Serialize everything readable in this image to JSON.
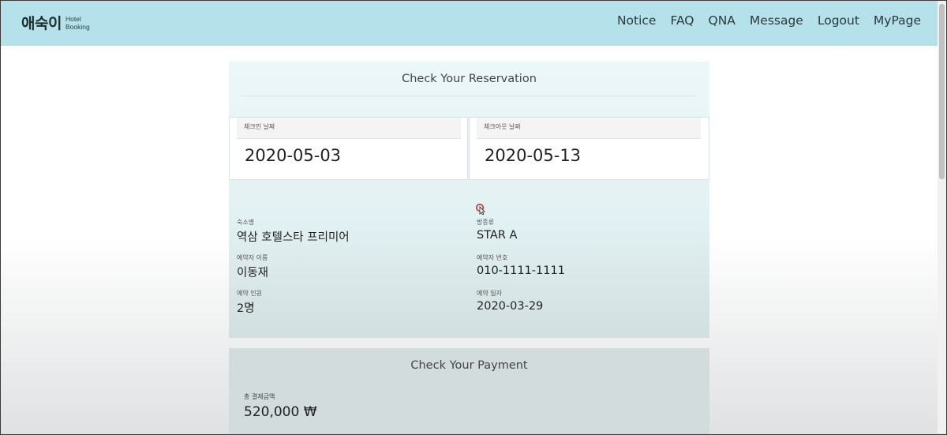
{
  "header": {
    "logo": {
      "main": "애숙이",
      "sub_line1": "Hotel",
      "sub_line2": "Booking"
    },
    "nav": [
      "Notice",
      "FAQ",
      "QNA",
      "Message",
      "Logout",
      "MyPage"
    ]
  },
  "reservation": {
    "title": "Check Your Reservation",
    "check_in": {
      "label": "체크인 날짜",
      "value": "2020-05-03"
    },
    "check_out": {
      "label": "체크아웃 날짜",
      "value": "2020-05-13"
    },
    "hotel_name": {
      "label": "숙소명",
      "value": "역삼 호텔스타 프리미어"
    },
    "room_type": {
      "label": "방종류",
      "value": "STAR A"
    },
    "guest_name": {
      "label": "예약자 이름",
      "value": "이동재"
    },
    "guest_phone": {
      "label": "예약자 번호",
      "value": "010-1111-1111"
    },
    "guest_count": {
      "label": "예약 인원",
      "value": "2명"
    },
    "reservation_date": {
      "label": "예약 일자",
      "value": "2020-03-29"
    }
  },
  "payment": {
    "title": "Check Your Payment",
    "total": {
      "label": "총 결제금액",
      "value": "520,000 ₩"
    }
  },
  "colors": {
    "header_bg": "#b4e1ea",
    "card_bg": "#ecf7f9",
    "payment_bg": "#d3dcdd",
    "cursor_ring": "#d9413a"
  }
}
